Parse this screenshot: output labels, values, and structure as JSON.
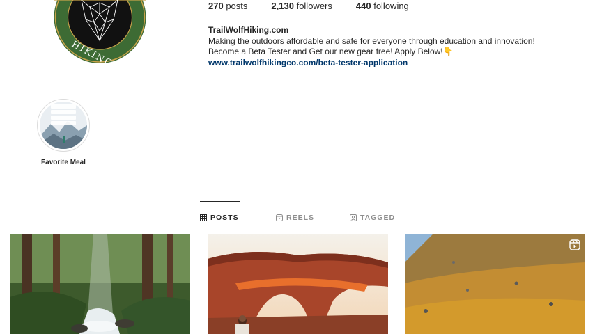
{
  "profile": {
    "logo_text": "HIKING CLUB",
    "stats": {
      "posts_count": "270",
      "posts_label": "posts",
      "followers_count": "2,130",
      "followers_label": "followers",
      "following_count": "440",
      "following_label": "following"
    },
    "bio": {
      "name": "TrailWolfHiking.com",
      "line1": "Making the outdoors affordable and safe for everyone through education and innovation!",
      "line2": "Become a Beta Tester and Get our new gear free! Apply Below!👇",
      "link": "www.trailwolfhikingco.com/beta-tester-application"
    }
  },
  "highlights": [
    {
      "label": "Favorite Meal"
    }
  ],
  "tabs": [
    {
      "label": "POSTS",
      "icon": "grid-icon",
      "active": true
    },
    {
      "label": "REELS",
      "icon": "reels-icon",
      "active": false
    },
    {
      "label": "TAGGED",
      "icon": "tagged-icon",
      "active": false
    }
  ],
  "posts": [
    {
      "subject": "forest-waterfall",
      "reel": false
    },
    {
      "subject": "desert-arch",
      "reel": false
    },
    {
      "subject": "autumn-hillside",
      "reel": true
    }
  ],
  "colors": {
    "logo_ring": "#3d6b34",
    "logo_gold": "#c8a24a",
    "link": "#00376b",
    "text": "#262626",
    "muted": "#8e8e8e",
    "divider": "#dbdbdb"
  }
}
